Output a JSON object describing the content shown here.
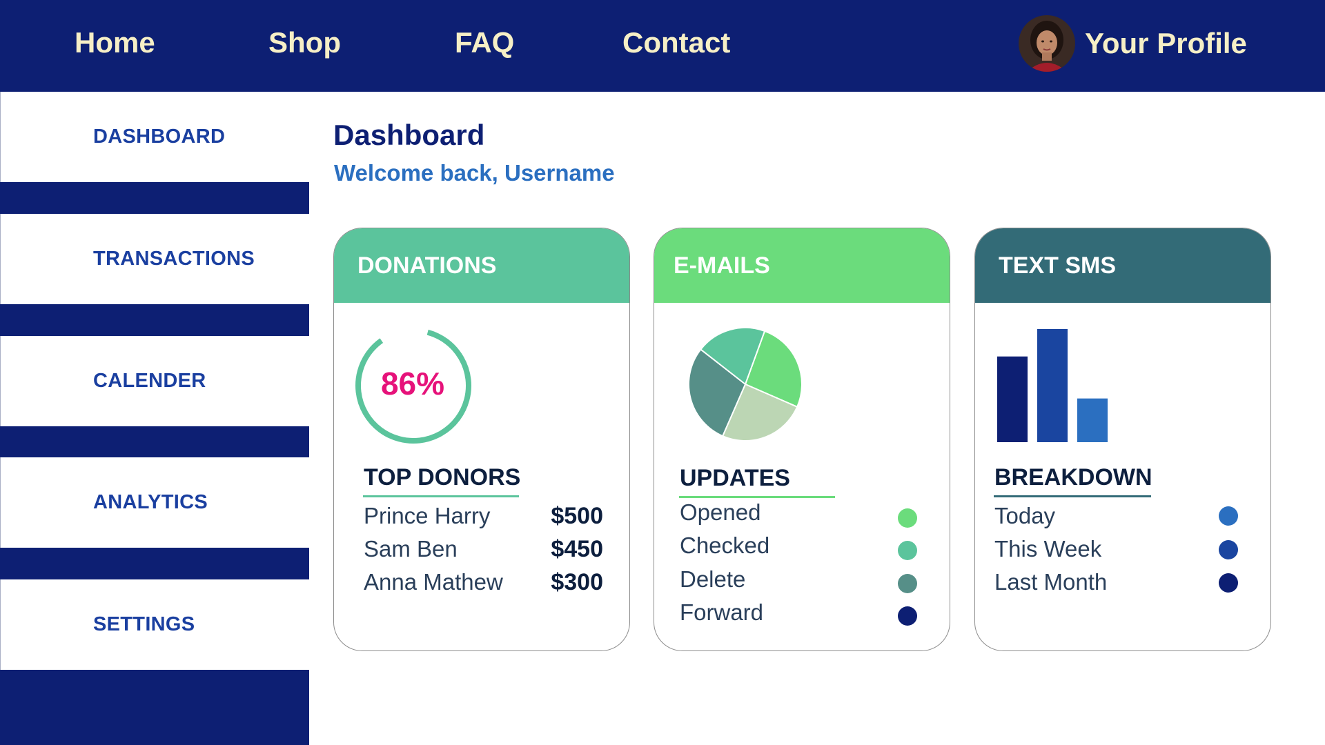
{
  "nav": {
    "links": [
      {
        "label": "Home"
      },
      {
        "label": "Shop"
      },
      {
        "label": "FAQ"
      },
      {
        "label": "Contact"
      }
    ],
    "profile_label": "Your Profile"
  },
  "sidebar": {
    "items": [
      {
        "label": "DASHBOARD"
      },
      {
        "label": "TRANSACTIONS"
      },
      {
        "label": "CALENDER"
      },
      {
        "label": "ANALYTICS"
      },
      {
        "label": "SETTINGS"
      }
    ]
  },
  "main": {
    "title": "Dashboard",
    "welcome": "Welcome back, Username"
  },
  "colors": {
    "navy": "#0d1f73",
    "cream": "#f6efc6",
    "donations": "#5bc49c",
    "emails": "#6bdc7c",
    "sms": "#336b77",
    "percent": "#e6127a"
  },
  "cards": {
    "donations": {
      "header": "DONATIONS",
      "progress_label": "86%",
      "progress_value": 86,
      "section_title": "TOP DONORS",
      "donors": [
        {
          "name": "Prince Harry",
          "amount": "$500"
        },
        {
          "name": "Sam Ben",
          "amount": "$450"
        },
        {
          "name": "Anna Mathew",
          "amount": "$300"
        }
      ]
    },
    "emails": {
      "header": "E-MAILS",
      "section_title": "UPDATES",
      "items": [
        {
          "label": "Opened",
          "color": "#6bdc7c"
        },
        {
          "label": "Checked",
          "color": "#5bc49c"
        },
        {
          "label": "Delete",
          "color": "#568f88"
        },
        {
          "label": "Forward",
          "color": "#0d1f73"
        }
      ]
    },
    "sms": {
      "header": "TEXT SMS",
      "section_title": "BREAKDOWN",
      "items": [
        {
          "label": "Today",
          "color": "#2b6fc0"
        },
        {
          "label": "This Week",
          "color": "#1a45a0"
        },
        {
          "label": "Last Month",
          "color": "#0d1f73"
        }
      ]
    }
  },
  "chart_data": [
    {
      "type": "pie",
      "slices": [
        {
          "color": "#6bdc7c",
          "value": 26
        },
        {
          "color": "#bcd6b4",
          "value": 25
        },
        {
          "color": "#568f88",
          "value": 29
        },
        {
          "color": "#5bc49c",
          "value": 20
        }
      ]
    },
    {
      "type": "bar",
      "values": [
        100,
        132,
        51
      ],
      "colors": [
        "#0d1f73",
        "#1a45a0",
        "#2b6fc0"
      ]
    }
  ]
}
